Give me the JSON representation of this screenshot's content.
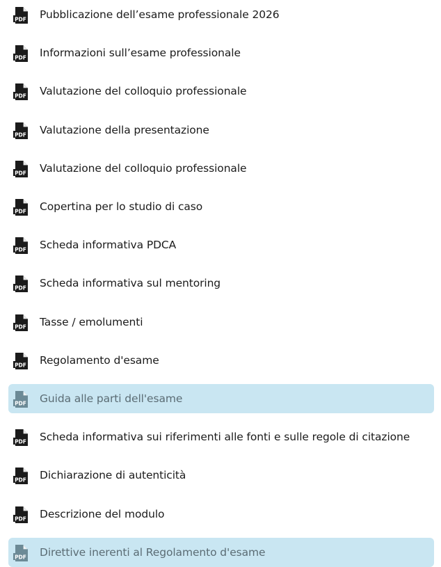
{
  "documents": {
    "icon": "pdf-file-icon",
    "icon_badge": "PDF",
    "colors": {
      "icon_default": "#1b1b1b",
      "icon_highlighted": "#6c8a96",
      "highlight_background": "#c9e6f2",
      "text_default": "#1b1b1b",
      "text_highlighted": "#5b6c74"
    },
    "items": [
      {
        "label": "Pubblicazione dell’esame professionale 2026",
        "highlighted": false
      },
      {
        "label": "Informazioni sull’esame professionale",
        "highlighted": false
      },
      {
        "label": "Valutazione del colloquio professionale",
        "highlighted": false
      },
      {
        "label": "Valutazione della presentazione",
        "highlighted": false
      },
      {
        "label": "Valutazione del colloquio professionale",
        "highlighted": false
      },
      {
        "label": "Copertina per lo studio di caso",
        "highlighted": false
      },
      {
        "label": "Scheda informativa PDCA",
        "highlighted": false
      },
      {
        "label": "Scheda informativa sul mentoring",
        "highlighted": false
      },
      {
        "label": "Tasse / emolumenti",
        "highlighted": false
      },
      {
        "label": "Regolamento d'esame",
        "highlighted": false
      },
      {
        "label": "Guida alle parti dell'esame",
        "highlighted": true
      },
      {
        "label": "Scheda informativa sui riferimenti alle fonti e sulle regole di citazione",
        "highlighted": false
      },
      {
        "label": "Dichiarazione di autenticità",
        "highlighted": false
      },
      {
        "label": "Descrizione del modulo",
        "highlighted": false
      },
      {
        "label": "Direttive inerenti al Regolamento d'esame",
        "highlighted": true
      }
    ]
  }
}
